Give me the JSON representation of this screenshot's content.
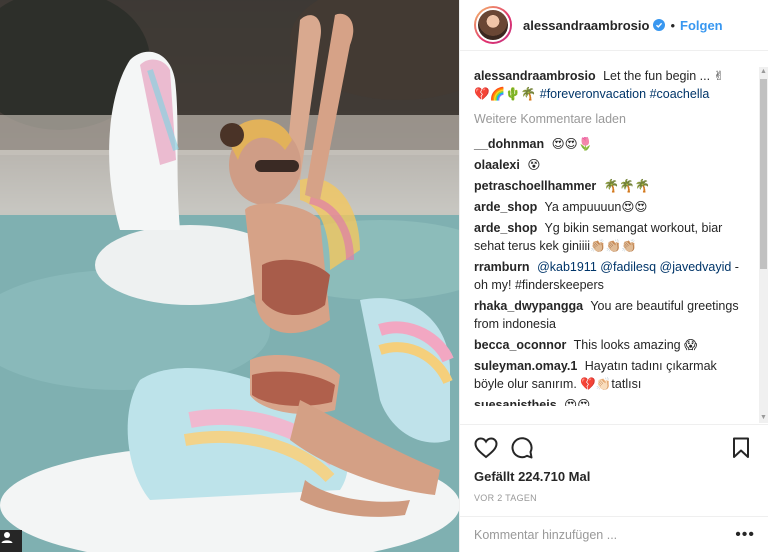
{
  "post": {
    "author": "alessandraambrosio",
    "separator": "•",
    "follow_label": "Folgen",
    "caption": {
      "username": "alessandraambrosio",
      "text": "Let the fun begin ... ✌",
      "emoji_line": "💔🌈🌵🌴",
      "hashtags": [
        "#foreveronvacation",
        "#coachella"
      ]
    },
    "load_more_label": "Weitere Kommentare laden",
    "comments": [
      {
        "username": "__dohnman",
        "text": "😍😍🌷"
      },
      {
        "username": "olaalexi",
        "text": "😵"
      },
      {
        "username": "petraschoellhammer",
        "text": "🌴🌴🌴"
      },
      {
        "username": "arde_shop",
        "text": "Ya ampuuuun😍😍"
      },
      {
        "username": "arde_shop",
        "text": "Yg bikin semangat workout, biar sehat terus kek giniiii👏🏼👏🏼👏🏼"
      },
      {
        "username": "rramburn",
        "mentions": [
          "@kab1911",
          "@fadilesq",
          "@javedvayid"
        ],
        "text": "- oh my! #finderskeepers"
      },
      {
        "username": "rhaka_dwypangga",
        "text": "You are beautiful greetings from indonesia"
      },
      {
        "username": "becca_oconnor",
        "text": "This looks amazing 😱"
      },
      {
        "username": "suleyman.omay.1",
        "text": "Hayatın tadını çıkarmak böyle olur sanırım. 💔👏🏻tatlısı"
      },
      {
        "username": "suesanistheis",
        "text": "😍😍"
      }
    ],
    "likes_label": "Gefällt 224.710 Mal",
    "time_label": "VOR 2 TAGEN",
    "add_comment_placeholder": "Kommentar hinzufügen ...",
    "more_label": "•••"
  },
  "icons": {
    "like": "heart-outline-icon",
    "comment": "comment-bubble-icon",
    "save": "bookmark-outline-icon",
    "verified": "verified-badge-icon",
    "tag": "user-tag-icon"
  },
  "colors": {
    "link_blue": "#3897f0",
    "hashtag": "#003569",
    "muted": "#999999",
    "text": "#262626"
  }
}
